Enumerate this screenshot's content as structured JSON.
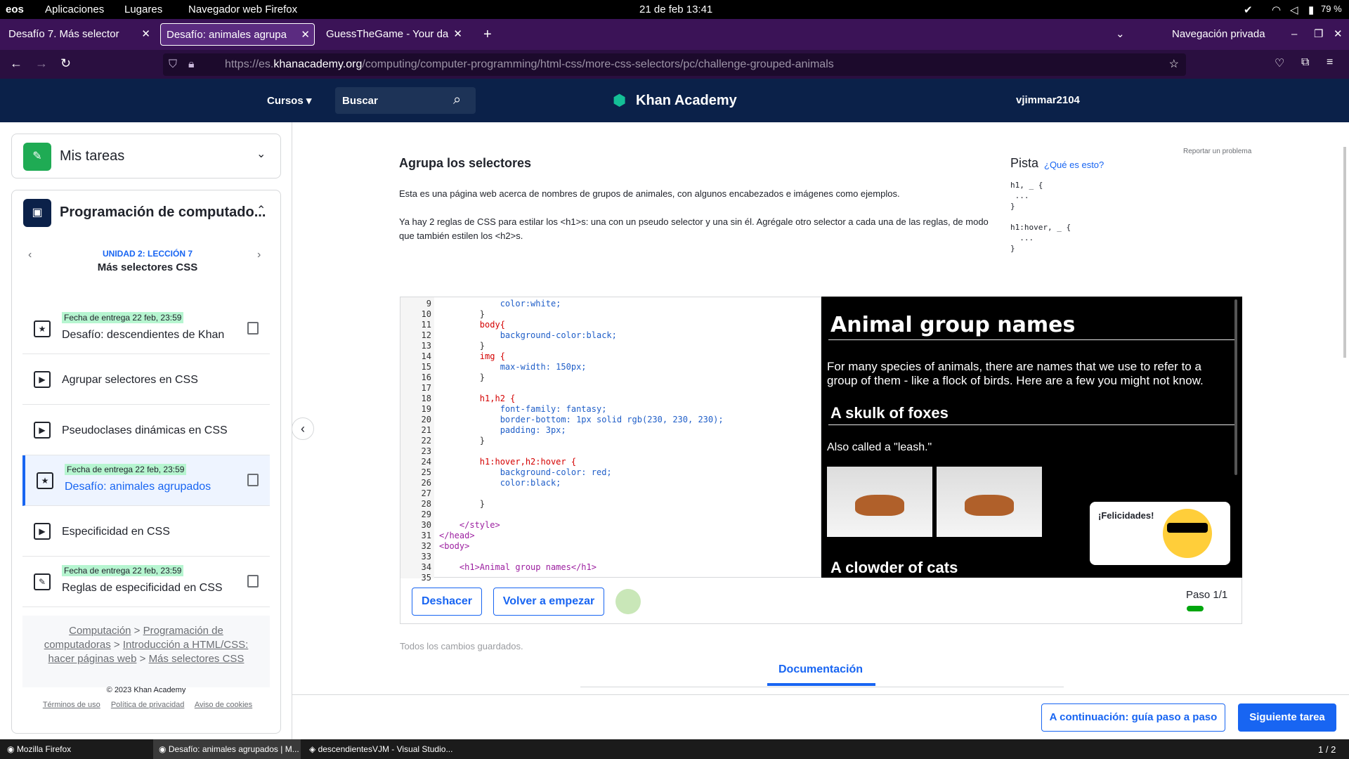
{
  "os": {
    "logo": "eos",
    "apps": "Aplicaciones",
    "places": "Lugares",
    "browser": "Navegador web Firefox",
    "clock": "21 de feb  13:41",
    "battery": "79 %"
  },
  "tabs": [
    {
      "label": "Desafío 7. Más selector"
    },
    {
      "label": "Desafío: animales agrupa"
    },
    {
      "label": "GuessTheGame - Your da"
    }
  ],
  "private": "Navegación privada",
  "url": {
    "pre": "https://es.",
    "host": "khanacademy.org",
    "path": "/computing/computer-programming/html-css/more-css-selectors/pc/challenge-grouped-animals"
  },
  "header": {
    "courses": "Cursos",
    "search": "Buscar",
    "logo": "Khan Academy",
    "user": "vjimmar2104"
  },
  "sidebar": {
    "tasks": "Mis tareas",
    "course": "Programación de computado...",
    "unit": "UNIDAD 2: LECCIÓN 7",
    "lesson": "Más selectores CSS",
    "items": [
      {
        "due": "Fecha de entrega 22 feb, 23:59",
        "title": "Desafío: descendientes de Khan"
      },
      {
        "due": "",
        "title": "Agrupar selectores en CSS"
      },
      {
        "due": "",
        "title": "Pseudoclases dinámicas en CSS"
      },
      {
        "due": "Fecha de entrega 22 feb, 23:59",
        "title": "Desafío: animales agrupados"
      },
      {
        "due": "",
        "title": "Especificidad en CSS"
      },
      {
        "due": "Fecha de entrega 22 feb, 23:59",
        "title": "Reglas de especificidad en CSS"
      }
    ],
    "crumbs": [
      "Computación",
      "Programación de computadoras",
      "Introducción a HTML/CSS: hacer páginas web",
      "Más selectores CSS"
    ],
    "copyright": "© 2023 Khan Academy",
    "footer": [
      "Términos de uso",
      "Política de privacidad",
      "Aviso de cookies"
    ]
  },
  "challenge": {
    "report": "Reportar un problema",
    "title": "Agrupa los selectores",
    "p1": "Esta es una página web acerca de nombres de grupos de animales, con algunos encabezados e imágenes como ejemplos.",
    "p2": "Ya hay 2 reglas de CSS para estilar los <h1>s: una con un pseudo selector y una sin él. Agrégale otro selector a cada una de las reglas, de modo que también estilen los <h2>s.",
    "hint": "Pista",
    "what": "¿Qué es esto?",
    "hintcode": "h1, _ {\n ...\n}\n\nh1:hover, _ {\n  ...\n}"
  },
  "code": {
    "lines": [
      "9",
      "10",
      "11",
      "12",
      "13",
      "14",
      "15",
      "16",
      "17",
      "18",
      "19",
      "20",
      "21",
      "22",
      "23",
      "24",
      "25",
      "26",
      "27",
      "28",
      "29",
      "30",
      "31",
      "32",
      "33",
      "34",
      "35"
    ],
    "text": [
      "            color:white;",
      "        }",
      "        body{",
      "            background-color:black;",
      "        }",
      "        img {",
      "            max-width: 150px;",
      "        }",
      "",
      "        h1,h2 {",
      "            font-family: fantasy;",
      "            border-bottom: 1px solid rgb(230, 230, 230);",
      "            padding: 3px;",
      "        }",
      "",
      "        h1:hover,h2:hover {",
      "            background-color: red;",
      "            color:black;",
      "",
      "        }",
      "",
      "    </style>",
      "</head>",
      "<body>",
      "",
      "    <h1>Animal group names</h1>",
      ""
    ]
  },
  "preview": {
    "h1": "Animal group names",
    "p": "For many species of animals, there are names that we use to refer to a group of them - like a flock of birds. Here are a few you might not know.",
    "h2a": "A skulk of foxes",
    "p2": "Also called a \"leash.\"",
    "h2b": "A clowder of cats",
    "congrats": "¡Felicidades!"
  },
  "controls": {
    "undo": "Deshacer",
    "restart": "Volver a empezar",
    "step": "Paso 1/1",
    "saved": "Todos los cambios guardados.",
    "docs": "Documentación",
    "next_guide": "A continuación: guía paso a paso",
    "next_task": "Siguiente tarea"
  },
  "taskbar": [
    "Mozilla Firefox",
    "Desafío: animales agrupados | M...",
    "descendientesVJM - Visual Studio..."
  ],
  "pager": "1 / 2"
}
